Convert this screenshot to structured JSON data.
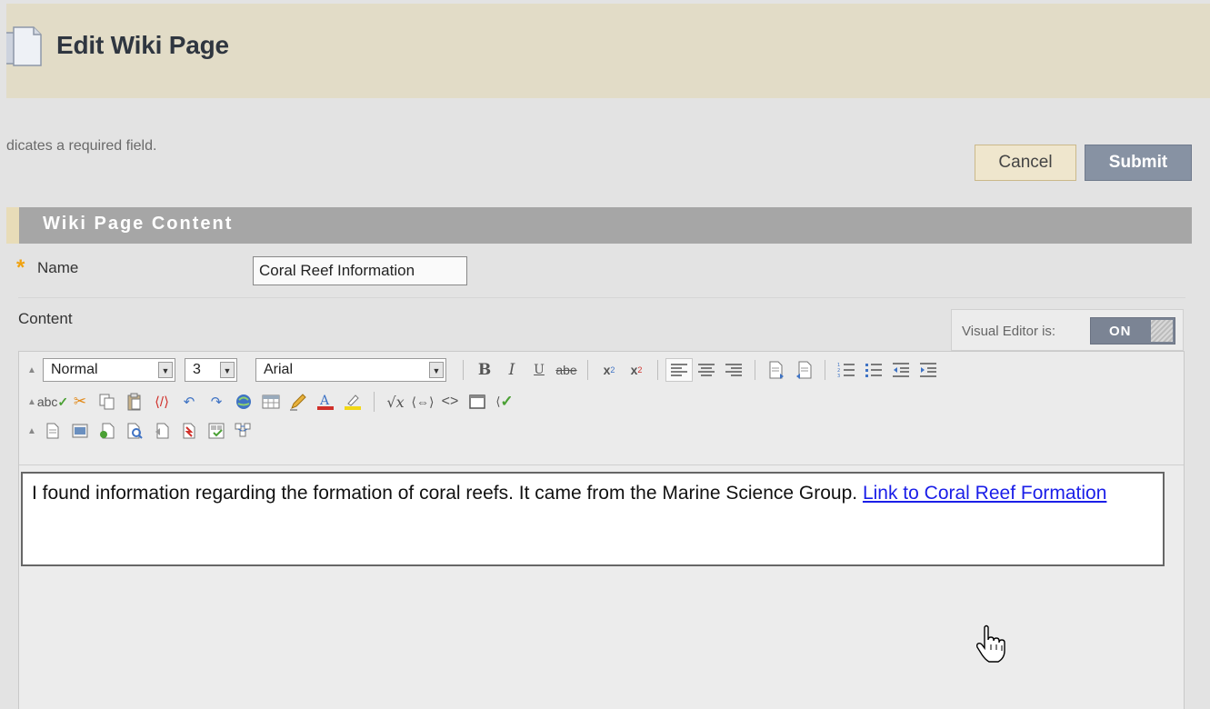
{
  "header": {
    "title": "Edit Wiki Page",
    "icon": "page-icon"
  },
  "required_note": "dicates a required field.",
  "buttons": {
    "cancel": "Cancel",
    "submit": "Submit"
  },
  "section": {
    "title": "Wiki Page Content"
  },
  "name_field": {
    "required_marker": "*",
    "label": "Name",
    "value": "Coral Reef Information"
  },
  "content_field": {
    "label": "Content"
  },
  "visual_editor": {
    "label": "Visual Editor is:",
    "state": "ON"
  },
  "toolbar": {
    "format": "Normal",
    "size": "3",
    "font": "Arial",
    "bold": "B",
    "italic": "I",
    "underline": "U",
    "strikethrough": "abe",
    "spellcheck": "abc"
  },
  "editor_body": {
    "text": "I found information regarding the formation of coral reefs. It came from the Marine Science Group. ",
    "link_text": "Link to Coral Reef Formation"
  },
  "colors": {
    "header_bg": "#e2dcc7",
    "section_bar": "#a6a6a6",
    "submit_bg": "#8792a3",
    "cancel_bg": "#efe6cd",
    "required_star": "#f0a20f",
    "link": "#1a1ee8"
  }
}
